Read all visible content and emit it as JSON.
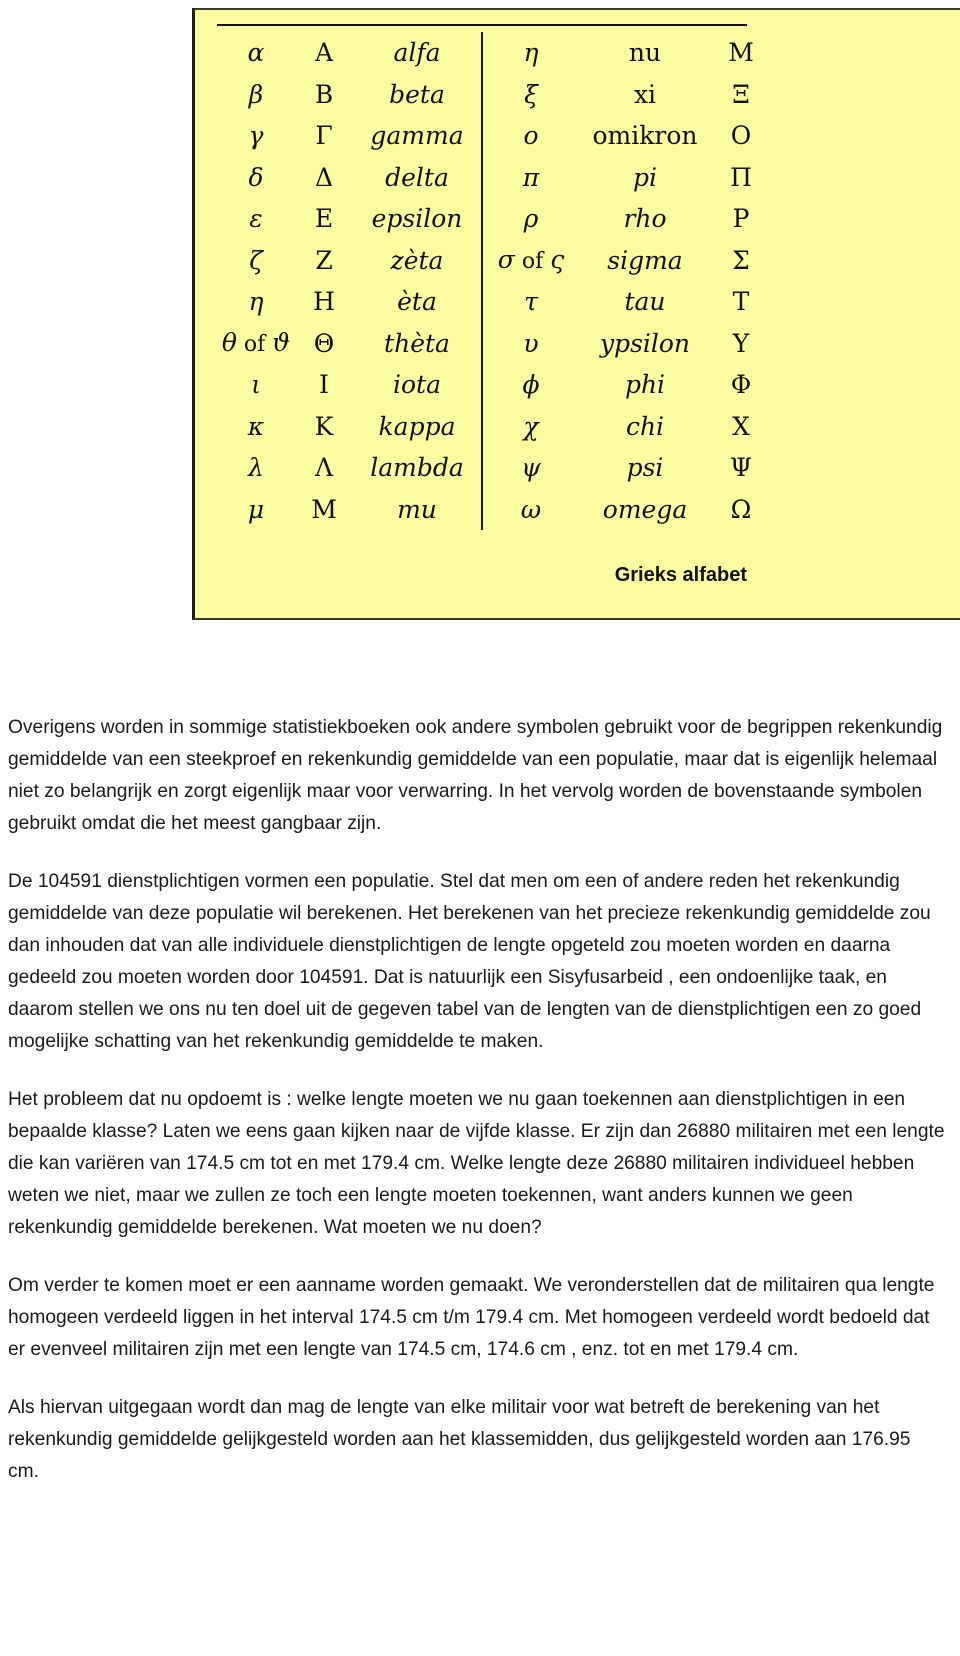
{
  "figure": {
    "caption": "Grieks alfabet",
    "background_color": "#fbfba0",
    "rows": [
      {
        "sym": "α",
        "cap": "A",
        "name": "alfa",
        "name_style": "italic",
        "sym_r": "η",
        "name_r": "nu",
        "name_r_style": "upright",
        "cap_r": "M"
      },
      {
        "sym": "β",
        "cap": "B",
        "name": "beta",
        "name_style": "italic",
        "sym_r": "ξ",
        "name_r": "xi",
        "name_r_style": "upright",
        "cap_r": "Ξ"
      },
      {
        "sym": "γ",
        "cap": "Γ",
        "name": "gamma",
        "name_style": "italic",
        "sym_r": "o",
        "name_r": "omikron",
        "name_r_style": "upright",
        "cap_r": "O"
      },
      {
        "sym": "δ",
        "cap": "Δ",
        "name": "delta",
        "name_style": "italic",
        "sym_r": "π",
        "name_r": "pi",
        "name_r_style": "italic",
        "cap_r": "Π"
      },
      {
        "sym": "ε",
        "cap": "E",
        "name": "epsilon",
        "name_style": "italic",
        "sym_r": "ρ",
        "name_r": "rho",
        "name_r_style": "italic",
        "cap_r": "P"
      },
      {
        "sym": "ζ",
        "cap": "Z",
        "name": "zèta",
        "name_style": "italic",
        "sym_r": "σ of ς",
        "name_r": "sigma",
        "name_r_style": "italic",
        "cap_r": "Σ"
      },
      {
        "sym": "η",
        "cap": "H",
        "name": "èta",
        "name_style": "italic",
        "sym_r": "τ",
        "name_r": "tau",
        "name_r_style": "italic",
        "cap_r": "T"
      },
      {
        "sym": "θ of ϑ",
        "cap": "Θ",
        "name": "thèta",
        "name_style": "italic",
        "sym_r": "υ",
        "name_r": "ypsilon",
        "name_r_style": "italic",
        "cap_r": "Y"
      },
      {
        "sym": "ι",
        "cap": "I",
        "name": "iota",
        "name_style": "italic",
        "sym_r": "ϕ",
        "name_r": "phi",
        "name_r_style": "italic",
        "cap_r": "Φ"
      },
      {
        "sym": "κ",
        "cap": "K",
        "name": "kappa",
        "name_style": "italic",
        "sym_r": "χ",
        "name_r": "chi",
        "name_r_style": "italic",
        "cap_r": "X"
      },
      {
        "sym": "λ",
        "cap": "Λ",
        "name": "lambda",
        "name_style": "italic",
        "sym_r": "ψ",
        "name_r": "psi",
        "name_r_style": "italic",
        "cap_r": "Ψ"
      },
      {
        "sym": "μ",
        "cap": "M",
        "name": "mu",
        "name_style": "italic",
        "sym_r": "ω",
        "name_r": "omega",
        "name_r_style": "italic",
        "cap_r": "Ω"
      }
    ]
  },
  "body": {
    "paragraphs": [
      "Overigens worden in sommige statistiekboeken ook andere symbolen gebruikt voor de begrippen rekenkundig gemiddelde van een steekproef en rekenkundig gemiddelde van een populatie, maar dat is eigenlijk helemaal niet zo belangrijk en zorgt eigenlijk maar voor verwarring. In het vervolg worden de bovenstaande symbolen gebruikt omdat die het meest gangbaar zijn.",
      "De 104591 dienstplichtigen vormen een populatie. Stel dat men om een of andere reden het rekenkundig gemiddelde van deze populatie wil berekenen. Het berekenen van het precieze rekenkundig gemiddelde zou dan inhouden dat van alle individuele dienstplichtigen de lengte opgeteld zou moeten worden en daarna gedeeld zou moeten worden door 104591. Dat is natuurlijk een Sisyfusarbeid , een ondoenlijke taak, en daarom stellen we ons nu ten doel uit de gegeven tabel van de lengten van de dienstplichtigen een zo goed mogelijke schatting van het rekenkundig gemiddelde te maken.",
      "Het probleem dat nu opdoemt is : welke lengte moeten we nu gaan toekennen aan dienstplichtigen in een bepaalde klasse? Laten we eens gaan kijken naar de vijfde klasse. Er zijn dan 26880 militairen met een lengte die kan variëren van 174.5 cm tot en met 179.4 cm. Welke lengte deze 26880 militairen individueel hebben weten we niet, maar we zullen ze toch een lengte moeten toekennen, want anders kunnen we geen rekenkundig gemiddelde berekenen. Wat moeten we nu doen?",
      "Om verder te komen moet er een aanname worden gemaakt. We veronderstellen dat de militairen qua lengte homogeen verdeeld liggen in het interval 174.5 cm t/m 179.4 cm. Met homogeen verdeeld wordt bedoeld dat er evenveel militairen zijn met een lengte van 174.5 cm, 174.6 cm , enz. tot en met 179.4 cm.",
      "Als hiervan uitgegaan wordt dan mag de lengte van elke militair voor wat betreft de berekening van het rekenkundig gemiddelde gelijkgesteld worden aan het klassemidden, dus gelijkgesteld worden aan 176.95 cm."
    ]
  }
}
